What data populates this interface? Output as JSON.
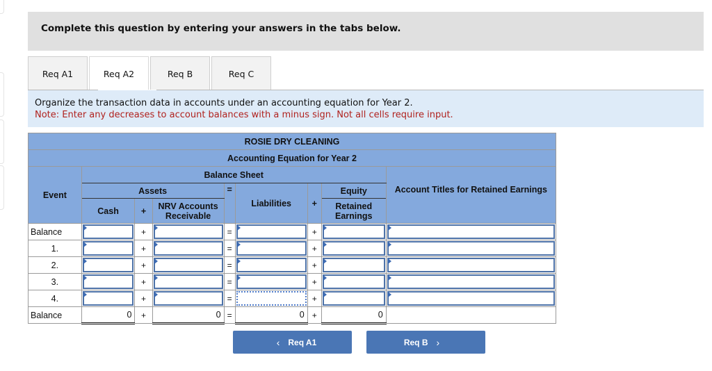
{
  "instruction": "Complete this question by entering your answers in the tabs below.",
  "tabs": [
    {
      "label": "Req A1",
      "active": false
    },
    {
      "label": "Req A2",
      "active": true
    },
    {
      "label": "Req B",
      "active": false
    },
    {
      "label": "Req C",
      "active": false
    }
  ],
  "info": {
    "line1": "Organize the transaction data in accounts under an accounting equation for Year 2.",
    "line2": "Note: Enter any decreases to account balances with a minus sign. Not all cells require input."
  },
  "table": {
    "company": "ROSIE DRY CLEANING",
    "subtitle": "Accounting Equation for Year 2",
    "balance_sheet": "Balance Sheet",
    "event_header": "Event",
    "assets_header": "Assets",
    "equity_header": "Equity",
    "cash_header": "Cash",
    "nrv_header": "NRV Accounts Receivable",
    "liabilities_header": "Liabilities",
    "retained_header": "Retained Earnings",
    "titles_header": "Account Titles for Retained Earnings",
    "plus": "+",
    "equals": "=",
    "rows": [
      {
        "event": "Balance",
        "cash": "",
        "nrv": "",
        "liabilities": "",
        "retained": "",
        "title": ""
      },
      {
        "event": "1.",
        "cash": "",
        "nrv": "",
        "liabilities": "",
        "retained": "",
        "title": ""
      },
      {
        "event": "2.",
        "cash": "",
        "nrv": "",
        "liabilities": "",
        "retained": "",
        "title": ""
      },
      {
        "event": "3.",
        "cash": "",
        "nrv": "",
        "liabilities": "",
        "retained": "",
        "title": ""
      },
      {
        "event": "4.",
        "cash": "",
        "nrv": "",
        "liabilities": "",
        "retained": "",
        "title": ""
      }
    ],
    "total": {
      "event": "Balance",
      "cash": "0",
      "nrv": "0",
      "liabilities": "0",
      "retained": "0"
    }
  },
  "nav": {
    "prev_label": "Req A1",
    "next_label": "Req B",
    "prev_icon": "‹",
    "next_icon": "›"
  }
}
